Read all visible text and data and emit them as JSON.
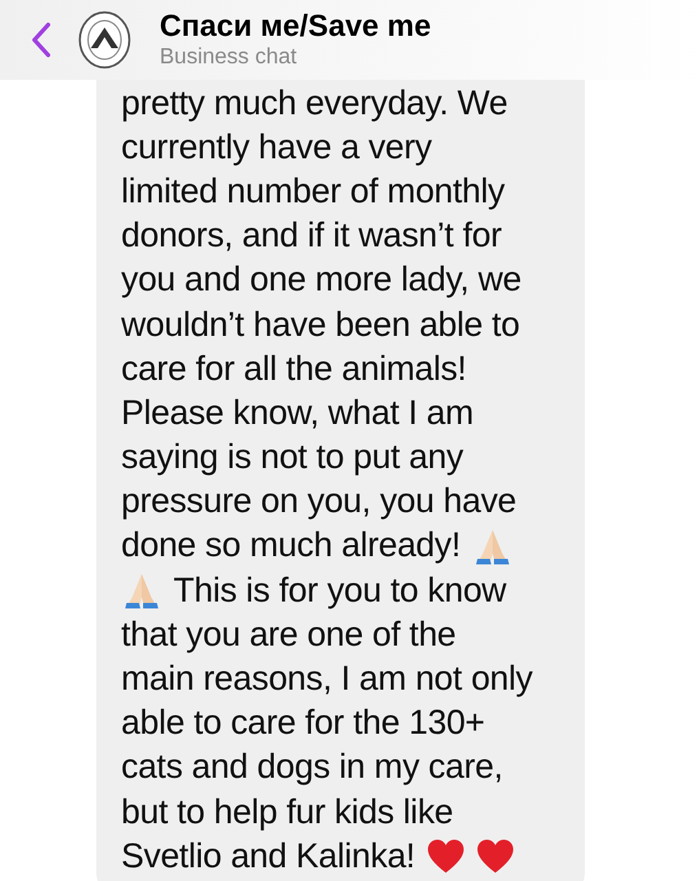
{
  "header": {
    "title": "Спаси ме/Save me",
    "subtitle": "Business chat"
  },
  "message": {
    "lines": [
      [
        {
          "kind": "text",
          "text": "pretty much everyday. We"
        }
      ],
      [
        {
          "kind": "text",
          "text": "currently have a very"
        }
      ],
      [
        {
          "kind": "text",
          "text": "limited number of monthly"
        }
      ],
      [
        {
          "kind": "text",
          "text": "donors, and if it wasn’t for"
        }
      ],
      [
        {
          "kind": "text",
          "text": "you and one more lady, we"
        }
      ],
      [
        {
          "kind": "text",
          "text": "wouldn’t have been able to"
        }
      ],
      [
        {
          "kind": "text",
          "text": "care for all the animals!"
        }
      ],
      [
        {
          "kind": "text",
          "text": "Please know, what I am"
        }
      ],
      [
        {
          "kind": "text",
          "text": "saying is not to put any"
        }
      ],
      [
        {
          "kind": "text",
          "text": "pressure on you, you have"
        }
      ],
      [
        {
          "kind": "text",
          "text": "done so much already!"
        },
        {
          "kind": "pray"
        }
      ],
      [
        {
          "kind": "pray"
        },
        {
          "kind": "text",
          "text": "This is for you to know"
        }
      ],
      [
        {
          "kind": "text",
          "text": "that you are one of the"
        }
      ],
      [
        {
          "kind": "text",
          "text": "main reasons, I am not only"
        }
      ],
      [
        {
          "kind": "text",
          "text": "able to care for the 130+"
        }
      ],
      [
        {
          "kind": "text",
          "text": "cats and dogs in my care,"
        }
      ],
      [
        {
          "kind": "text",
          "text": "but to help fur kids like"
        }
      ],
      [
        {
          "kind": "text",
          "text": "Svetlio and Kalinka!"
        },
        {
          "kind": "heart"
        },
        {
          "kind": "heart"
        }
      ]
    ]
  }
}
